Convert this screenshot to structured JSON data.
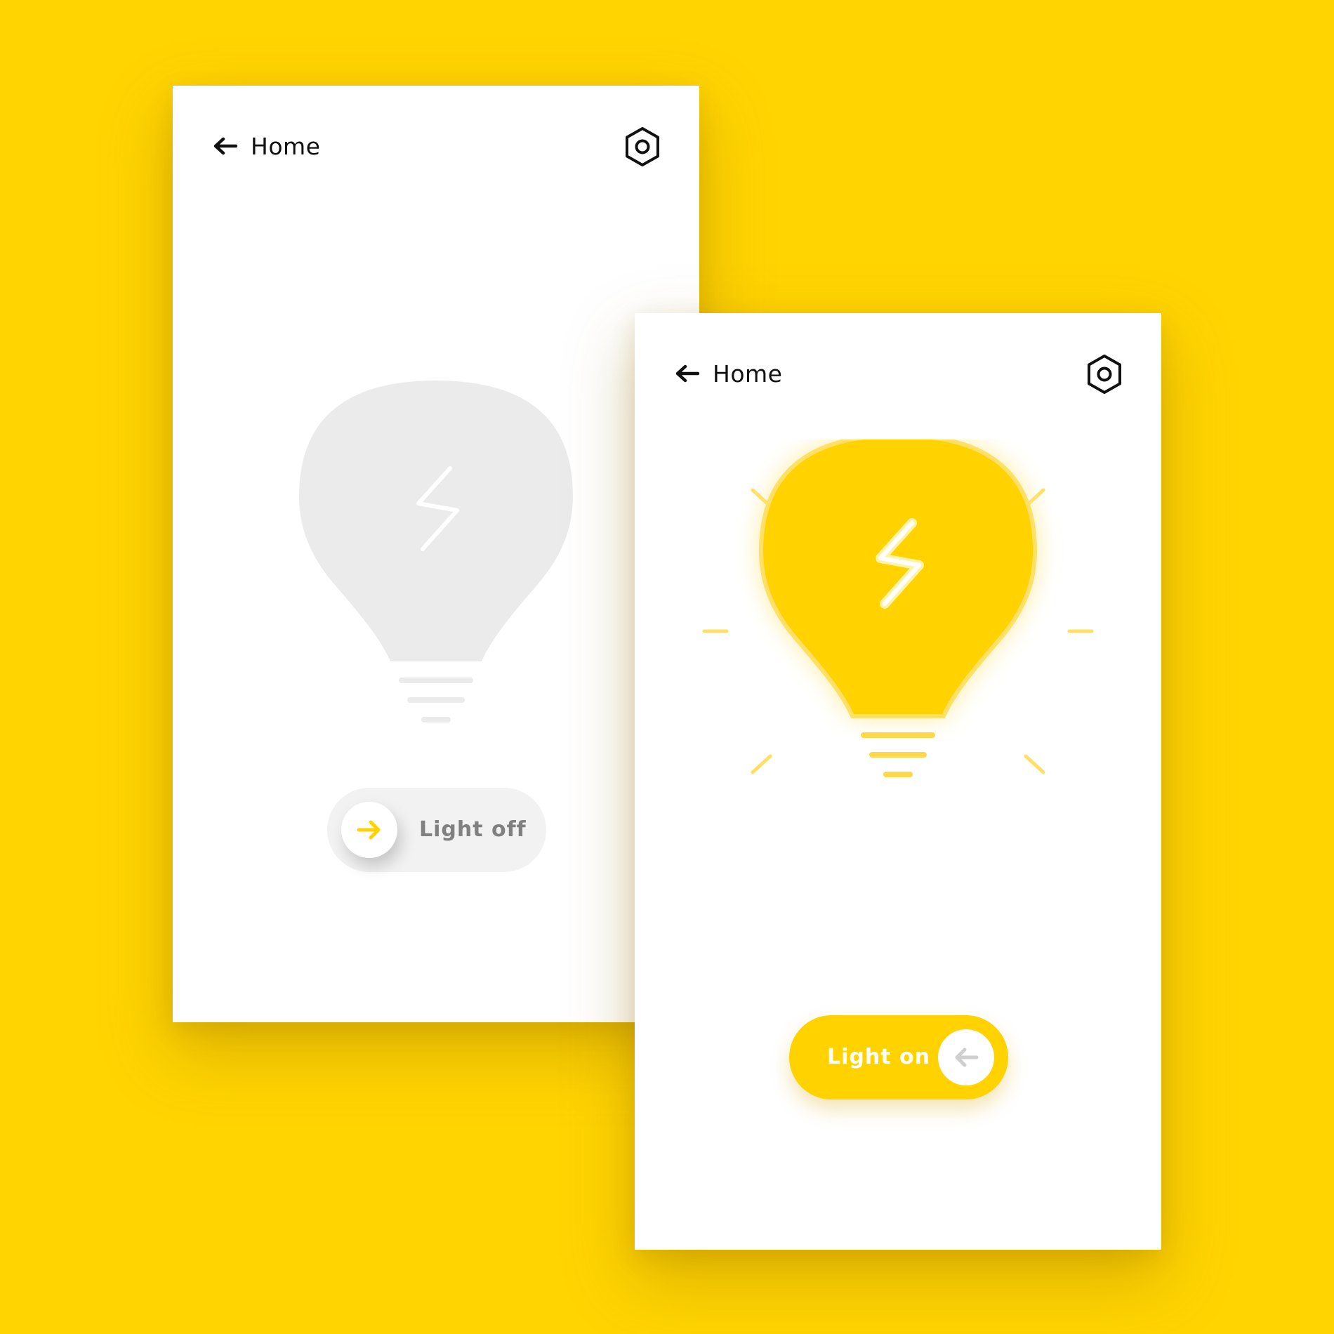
{
  "colors": {
    "background": "#FFD400",
    "accent": "#FFD200",
    "ray": "#FFE066",
    "bulb_off": "#EBEBEB",
    "text_dark": "#111111",
    "text_muted": "#808080"
  },
  "screens": [
    {
      "state": "off",
      "header": {
        "back_icon": "arrow-left-icon",
        "back_label": "Home",
        "settings_icon": "hexagon-settings-icon"
      },
      "bulb_icon": "lightbulb-off-icon",
      "toggle": {
        "label": "Light off",
        "is_on": false,
        "knob_icon": "arrow-right-icon"
      }
    },
    {
      "state": "on",
      "header": {
        "back_icon": "arrow-left-icon",
        "back_label": "Home",
        "settings_icon": "hexagon-settings-icon"
      },
      "bulb_icon": "lightbulb-on-icon",
      "toggle": {
        "label": "Light on",
        "is_on": true,
        "knob_icon": "arrow-left-icon"
      }
    }
  ]
}
